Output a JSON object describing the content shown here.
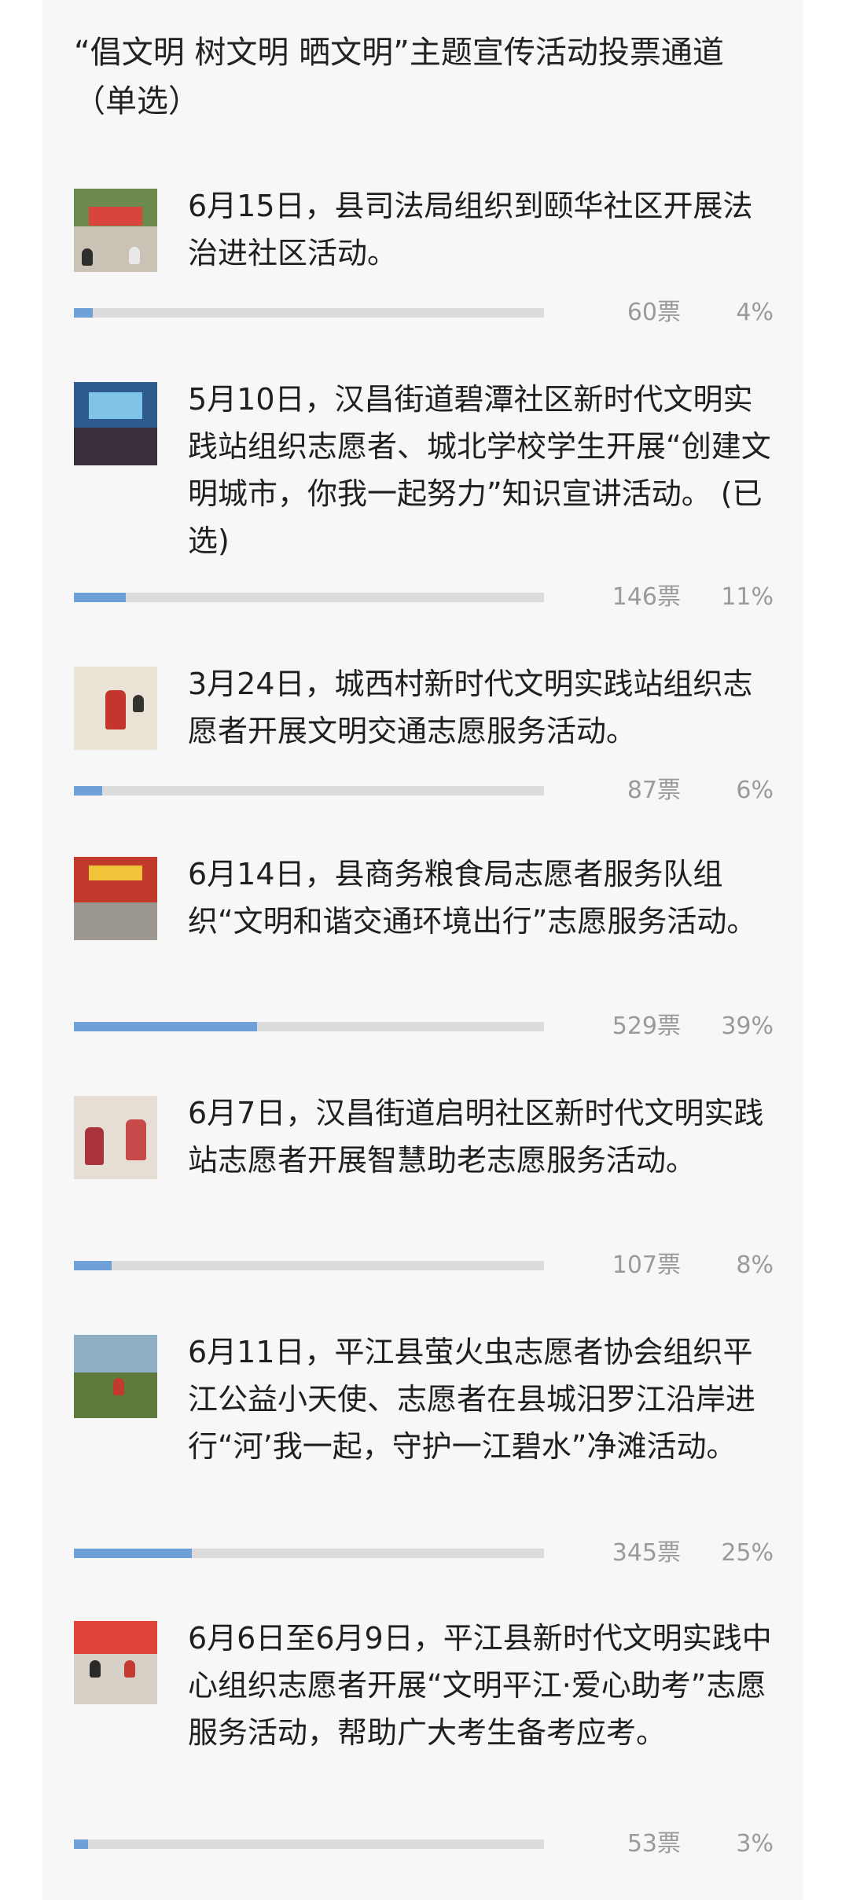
{
  "poll": {
    "title": "“倡文明 树文明 晒文明”主题宣传活动投票通道（单选）",
    "options": [
      {
        "text": "6月15日，县司法局组织到颐华社区开展法治进社区活动。",
        "votes": "60票",
        "percent": "4%",
        "share": 0.04
      },
      {
        "text": "5月10日，汉昌街道碧潭社区新时代文明实践站组织志愿者、城北学校学生开展“创建文明城市，你我一起努力”知识宣讲活动。 (已选)",
        "votes": "146票",
        "percent": "11%",
        "share": 0.11
      },
      {
        "text": "3月24日，城西村新时代文明实践站组织志愿者开展文明交通志愿服务活动。",
        "votes": "87票",
        "percent": "6%",
        "share": 0.06
      },
      {
        "text": "6月14日，县商务粮食局志愿者服务队组织“文明和谐交通环境出行”志愿服务活动。",
        "votes": "529票",
        "percent": "39%",
        "share": 0.39
      },
      {
        "text": "6月7日，汉昌街道启明社区新时代文明实践站志愿者开展智慧助老志愿服务活动。",
        "votes": "107票",
        "percent": "8%",
        "share": 0.08
      },
      {
        "text": "6月11日，平江县萤火虫志愿者协会组织平江公益小天使、志愿者在县城汨罗江沿岸进行“河’我一起，守护一江碧水”净滩活动。",
        "votes": "345票",
        "percent": "25%",
        "share": 0.25
      },
      {
        "text": "6月6日至6月9日，平江县新时代文明实践中心组织志愿者开展“文明平江·爱心助考”志愿服务活动，帮助广大考生备考应考。",
        "votes": "53票",
        "percent": "3%",
        "share": 0.03
      }
    ]
  },
  "colors": {
    "bar_fill": "#6fa0d8",
    "bar_track": "#dcdcdc",
    "card_bg": "#f7f7f7"
  }
}
